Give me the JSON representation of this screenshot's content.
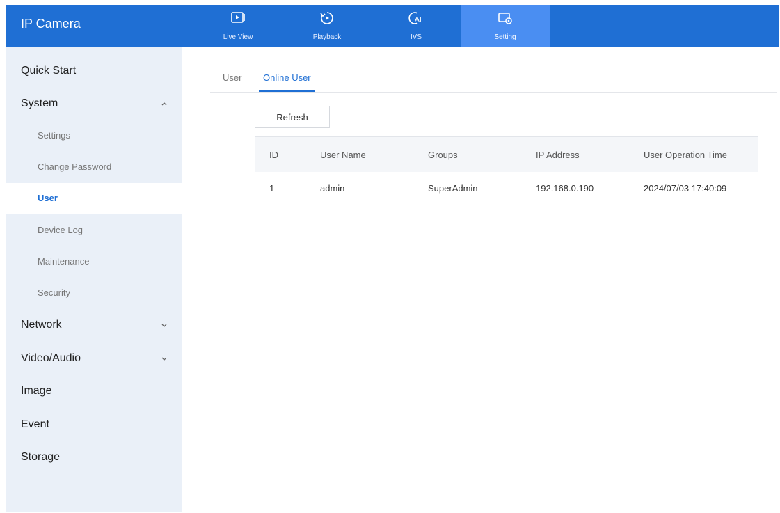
{
  "app": {
    "title": "IP Camera"
  },
  "nav": {
    "items": [
      {
        "label": "Live View",
        "icon": "live-view-icon"
      },
      {
        "label": "Playback",
        "icon": "playback-icon"
      },
      {
        "label": "IVS",
        "icon": "ivs-icon"
      },
      {
        "label": "Setting",
        "icon": "setting-icon",
        "active": true
      }
    ]
  },
  "sidebar": {
    "quick_start": "Quick Start",
    "system": "System",
    "system_sub": [
      "Settings",
      "Change Password",
      "User",
      "Device Log",
      "Maintenance",
      "Security"
    ],
    "network": "Network",
    "video_audio": "Video/Audio",
    "image": "Image",
    "event": "Event",
    "storage": "Storage",
    "selected": "User"
  },
  "tabs": {
    "user": "User",
    "online_user": "Online User",
    "active": "Online User"
  },
  "toolbar": {
    "refresh": "Refresh"
  },
  "table": {
    "headers": [
      "ID",
      "User Name",
      "Groups",
      "IP Address",
      "User Operation Time"
    ],
    "rows": [
      [
        "1",
        "admin",
        "SuperAdmin",
        "192.168.0.190",
        "2024/07/03 17:40:09"
      ]
    ]
  },
  "colors": {
    "primary": "#1f6fd4",
    "nav_active": "#4a8ef2",
    "sidebar_bg": "#eaf0f8"
  }
}
